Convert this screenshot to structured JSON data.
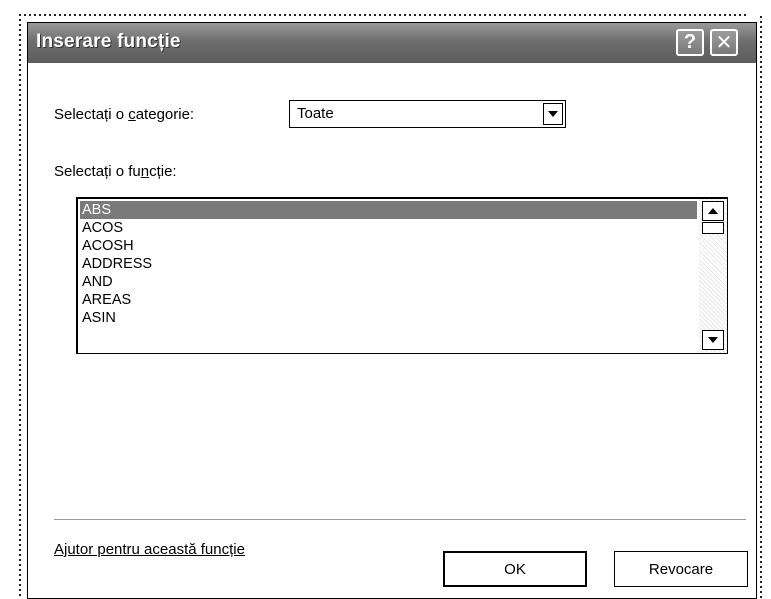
{
  "dialog": {
    "title": "Inserare funcție",
    "help_button": "?",
    "close_button": "✕"
  },
  "category": {
    "label_pre": "Selectați o ",
    "label_accel": "c",
    "label_post": "ategorie:",
    "value": "Toate"
  },
  "function": {
    "label_pre": "Selectați o fu",
    "label_accel": "n",
    "label_post": "cție:",
    "items": [
      "ABS",
      "ACOS",
      "ACOSH",
      "ADDRESS",
      "AND",
      "AREAS",
      "ASIN"
    ],
    "selected_index": 0
  },
  "footer": {
    "help_link": "Ajutor pentru această funcție",
    "ok_label": "OK",
    "cancel_label": "Revocare"
  },
  "colors": {
    "titlebar": "#6e6e6e",
    "selection": "#7a7a7a"
  }
}
